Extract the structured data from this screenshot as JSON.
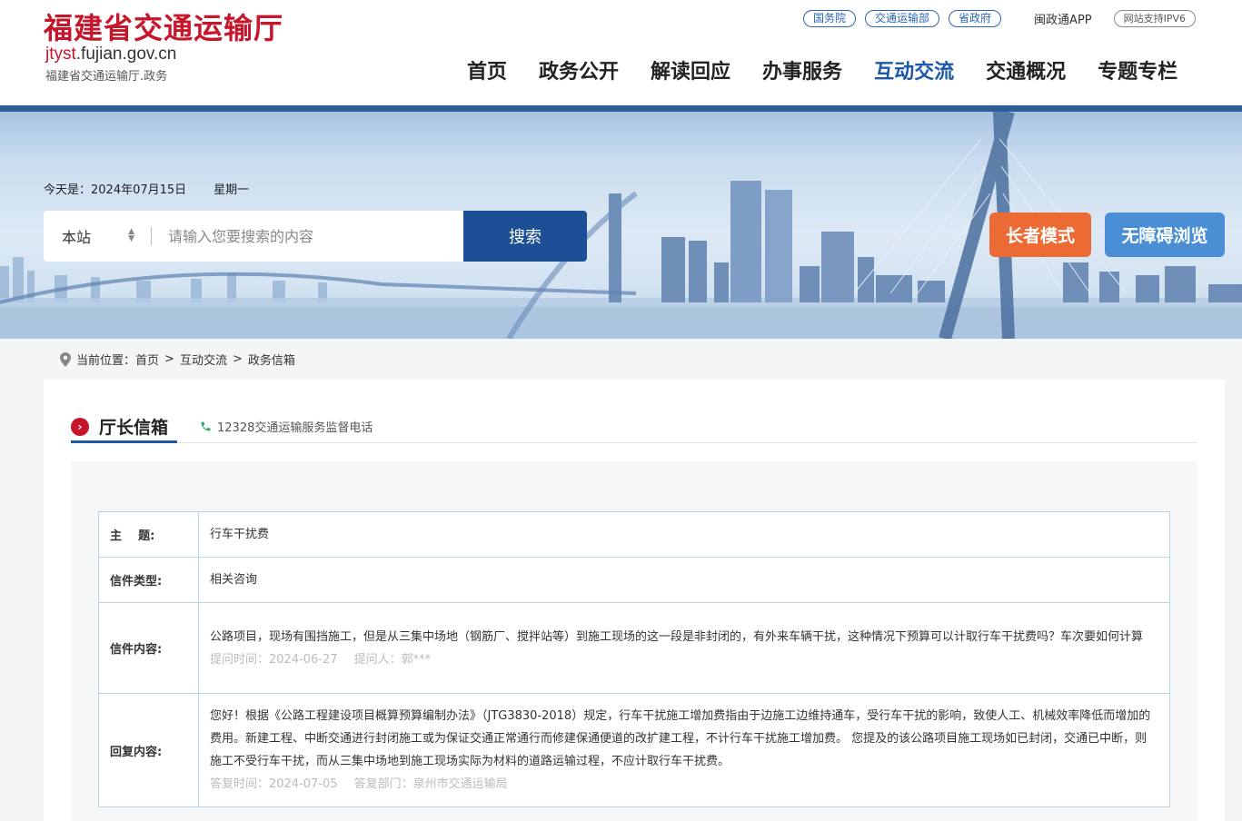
{
  "header": {
    "site_title": "福建省交通运输厅",
    "domain_accent": "jtyst",
    "domain_rest": ".fujian.gov.cn",
    "subtitle": "福建省交通运输厅.政务",
    "top_links": [
      "国务院",
      "交通运输部",
      "省政府"
    ],
    "app_link": "闽政通APP",
    "ipv6": "网站支持IPV6",
    "nav": [
      "首页",
      "政务公开",
      "解读回应",
      "办事服务",
      "互动交流",
      "交通概况",
      "专题专栏"
    ],
    "active_nav": "互动交流"
  },
  "banner": {
    "date_label": "今天是：2024年07月15日",
    "weekday": "星期一",
    "search_scope": "本站",
    "search_placeholder": "请输入您要搜索的内容",
    "search_button": "搜索",
    "elder_mode": "长者模式",
    "accessibility": "无障碍浏览"
  },
  "breadcrumb": {
    "prefix": "当前位置：",
    "items": [
      "首页",
      "互动交流",
      "政务信箱"
    ],
    "sep": ">"
  },
  "section": {
    "title": "厅长信箱",
    "hotline": "12328交通运输服务监督电话"
  },
  "letter": {
    "subject_label": "主    题:",
    "subject": "行车干扰费",
    "type_label": "信件类型:",
    "type": "相关咨询",
    "content_label": "信件内容:",
    "content": "公路项目，现场有围挡施工，但是从三集中场地（钢筋厂、搅拌站等）到施工现场的这一段是非封闭的，有外来车辆干扰，这种情况下预算可以计取行车干扰费吗？车次要如何计算",
    "ask_time": "提问时间：2024-06-27",
    "asker": "提问人：郭***",
    "reply_label": "回复内容:",
    "reply": "您好！根据《公路工程建设项目概算预算编制办法》（JTG3830-2018）规定，行车干扰施工增加费指由于边施工边维持通车，受行车干扰的影响，致使人工、机械效率降低而增加的费用。新建工程、中断交通进行封闭施工或为保证交通正常通行而修建保通便道的改扩建工程，不计行车干扰施工增加费。 您提及的该公路项目施工现场如已封闭，交通已中断，则施工不受行车干扰，而从三集中场地到施工现场实际为材料的道路运输过程，不应计取行车干扰费。",
    "reply_time": "答复时间：2024-07-05",
    "reply_dept": "答复部门：泉州市交通运输局"
  },
  "colors": {
    "brand_red": "#c6162b",
    "nav_active": "#1c58a8",
    "search_button": "#1c4f95",
    "elder_button": "#ec6b34",
    "access_button": "#4a8fd6"
  }
}
